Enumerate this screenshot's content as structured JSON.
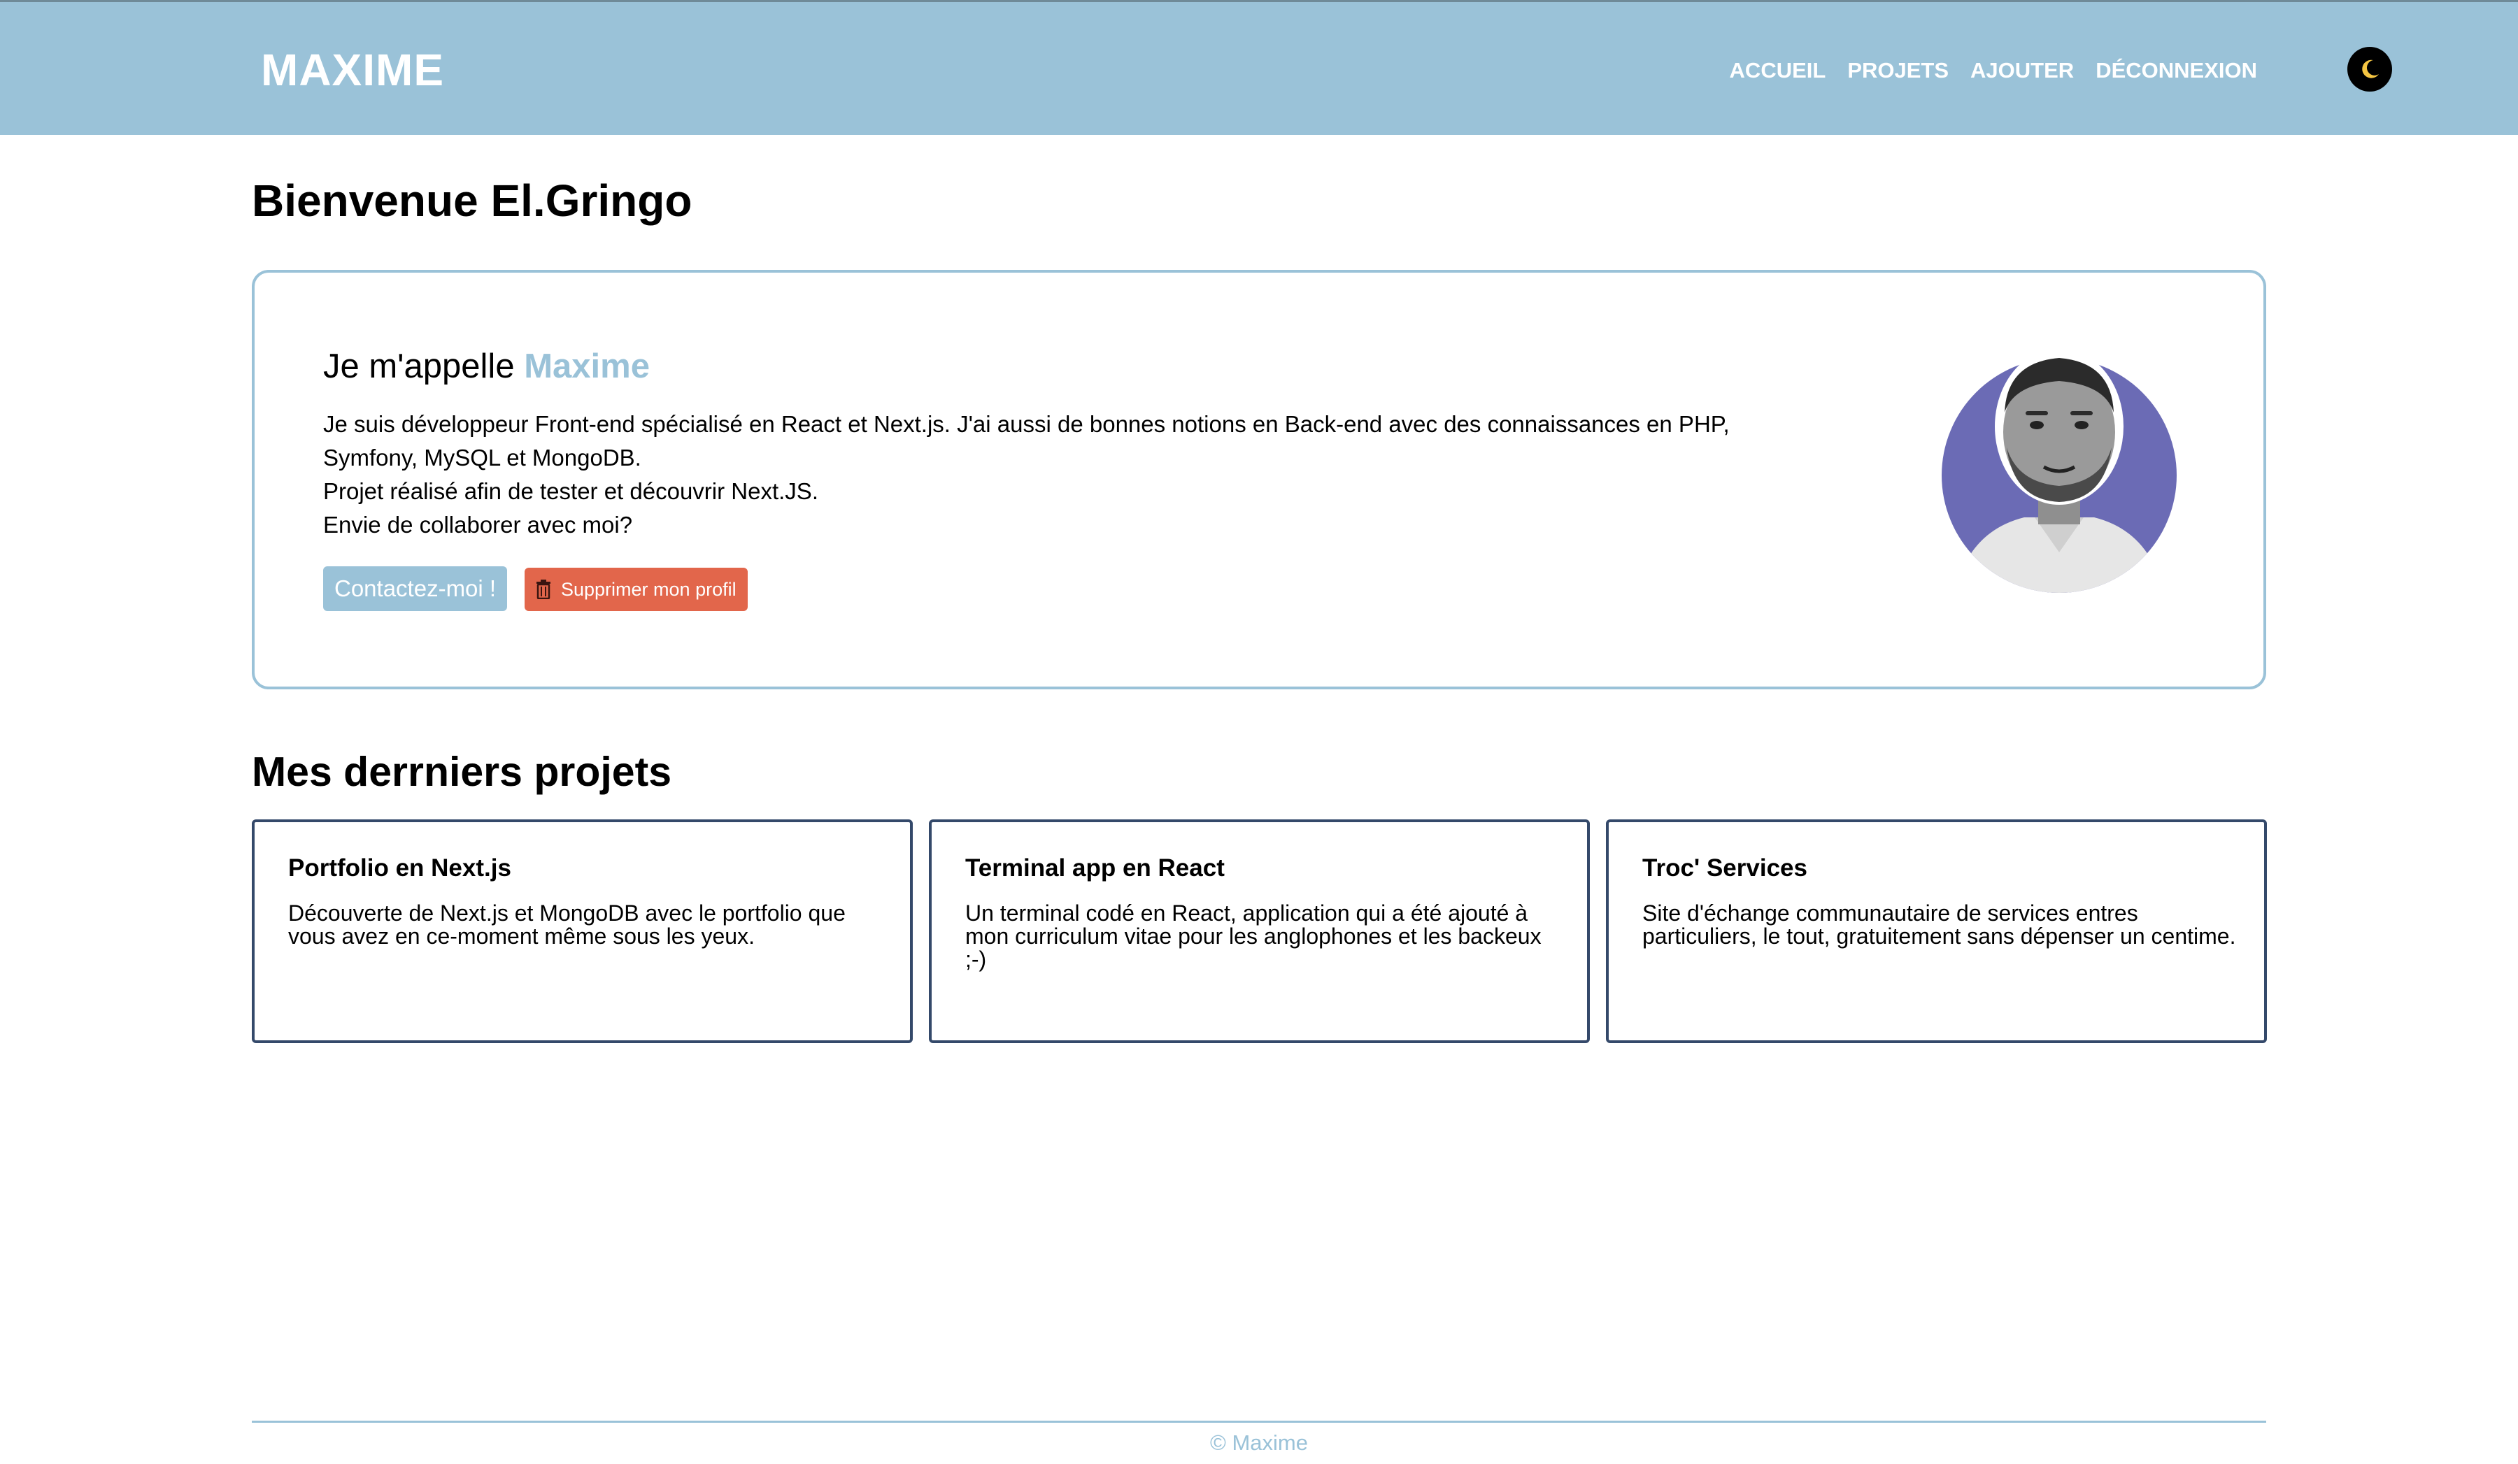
{
  "header": {
    "logo": "MAXIME",
    "nav": [
      "ACCUEIL",
      "PROJETS",
      "AJOUTER",
      "DÉCONNEXION"
    ],
    "theme_icon": "moon-icon"
  },
  "main": {
    "welcome": "Bienvenue El.Gringo",
    "intro": {
      "title_prefix": "Je m'appelle",
      "title_name": "Maxime",
      "paragraph1": "Je suis développeur Front-end spécialisé en React et Next.js. J'ai aussi de bonnes notions en Back-end avec des connaissances en PHP, Symfony, MySQL et MongoDB.",
      "paragraph2": "Projet réalisé afin de tester et découvrir Next.JS.",
      "paragraph3": "Envie de collaborer avec moi?",
      "contact_button": "Contactez-moi !",
      "delete_button": "Supprimer mon profil",
      "delete_icon": "trash-icon"
    },
    "projects_title": "Mes derrniers projets",
    "projects": [
      {
        "title": "Portfolio en Next.js",
        "description": "Découverte de Next.js et MongoDB avec le portfolio que vous avez en ce-moment même sous les yeux."
      },
      {
        "title": "Terminal app en React",
        "description": "Un terminal codé en React, application qui a été ajouté à mon curriculum vitae pour les anglophones et les backeux ;-)"
      },
      {
        "title": "Troc' Services",
        "description": "Site d'échange communautaire de services entres particuliers, le tout, gratuitement sans dépenser un centime."
      }
    ]
  },
  "footer": {
    "copyright": "© Maxime"
  },
  "colors": {
    "header_bg": "#9ac2d8",
    "accent": "#9ac2d8",
    "danger": "#e2664b",
    "card_border": "#34496a",
    "avatar_bg": "#6b6bb5"
  }
}
